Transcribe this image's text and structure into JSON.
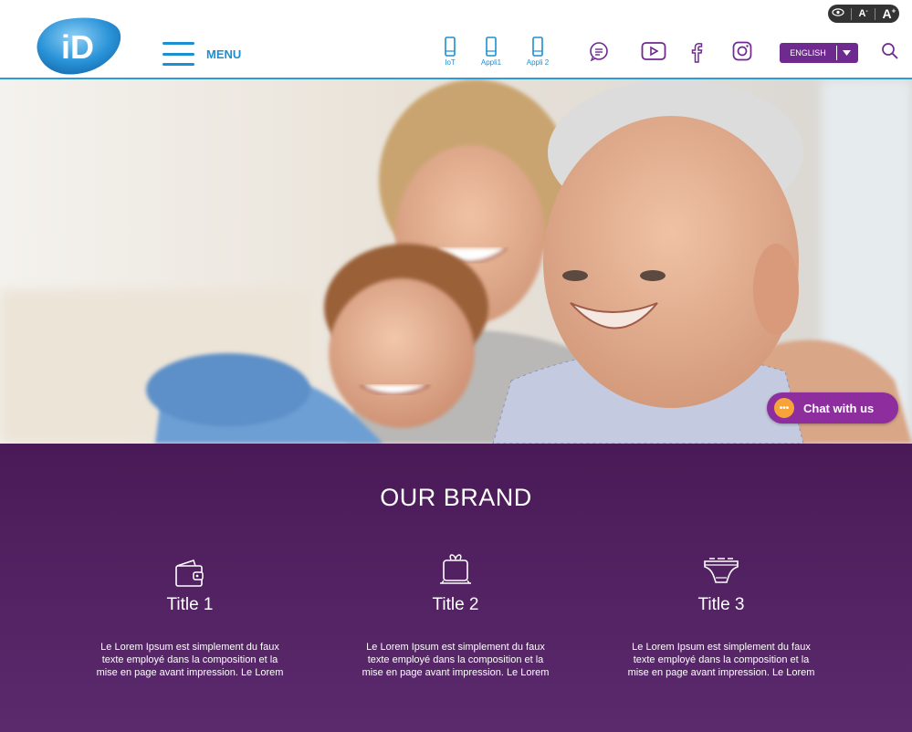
{
  "accessibility": {
    "contrast_icon": "eye-icon",
    "decrease_label": "A",
    "increase_label": "A"
  },
  "header": {
    "logo_text": "iD",
    "menu_label": "MENU",
    "apps": [
      {
        "label": "IoT",
        "icon": "phone-icon"
      },
      {
        "label": "Appli1",
        "icon": "phone-icon"
      },
      {
        "label": "Appli 2",
        "icon": "phone-icon"
      }
    ],
    "social": [
      "chat-bubble-icon",
      "youtube-icon",
      "facebook-icon",
      "instagram-icon"
    ],
    "language": "ENGLISH",
    "search_icon": "search-icon"
  },
  "hero": {
    "image": "family-photo"
  },
  "chat": {
    "label": "Chat with us"
  },
  "brand": {
    "title": "OUR BRAND",
    "items": [
      {
        "icon": "wallet-icon",
        "title": "Title 1",
        "text": "Le Lorem Ipsum est simplement du faux texte employé dans la composition et la mise en page avant impression. Le Lorem"
      },
      {
        "icon": "gift-icon",
        "title": "Title 2",
        "text": "Le Lorem Ipsum est simplement du faux texte employé dans la composition et la mise en page avant impression. Le Lorem"
      },
      {
        "icon": "diaper-icon",
        "title": "Title 3",
        "text": "Le Lorem Ipsum est simplement du faux texte employé dans la composition et la mise en page avant impression. Le Lorem"
      }
    ]
  },
  "colors": {
    "primary_blue": "#1b8fd2",
    "brand_purple": "#4a1a57",
    "chat_purple": "#8e2d9e",
    "lang_purple": "#6f2a8f"
  }
}
